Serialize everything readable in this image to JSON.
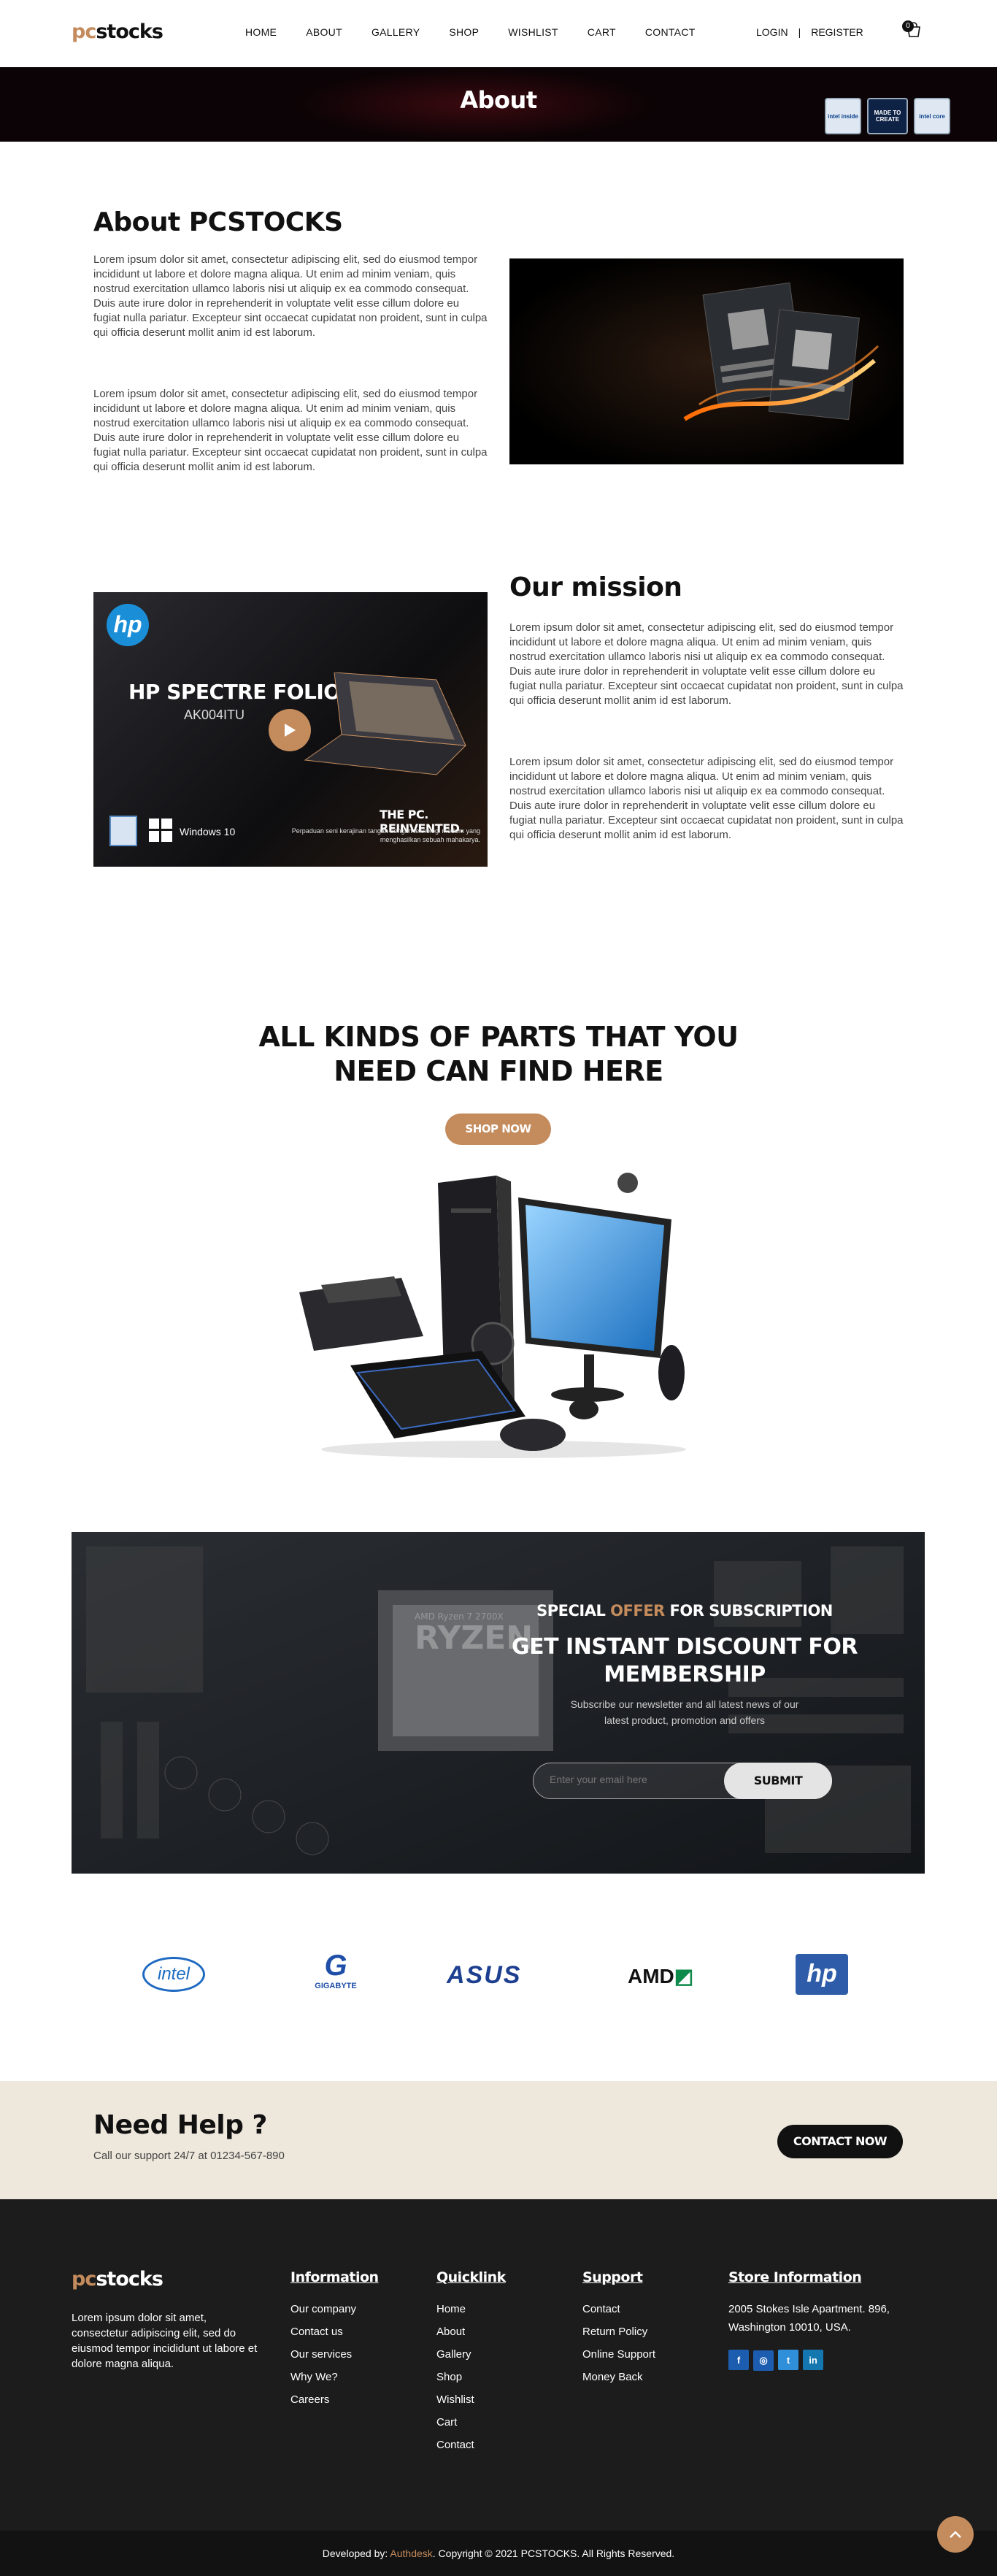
{
  "header": {
    "logo_pc": "pc",
    "logo_stocks": "stocks",
    "nav": [
      "HOME",
      "ABOUT",
      "GALLERY",
      "SHOP",
      "WISHLIST",
      "CART",
      "CONTACT"
    ],
    "login": "LOGIN",
    "separator": "|",
    "register": "REGISTER",
    "cart_count": "0"
  },
  "banner": {
    "title": "About",
    "badges": [
      "intel inside",
      "MADE TO CREATE",
      "intel core"
    ]
  },
  "about": {
    "title": "About PCSTOCKS",
    "p1": "Lorem ipsum dolor sit amet, consectetur adipiscing elit, sed do eiusmod tempor incididunt ut labore et dolore magna aliqua. Ut enim ad minim veniam, quis nostrud exercitation ullamco laboris nisi ut aliquip ex ea commodo consequat. Duis aute irure dolor in reprehenderit in voluptate velit esse cillum dolore eu fugiat nulla pariatur. Excepteur sint occaecat cupidatat non proident, sunt in culpa qui officia deserunt mollit anim id est laborum.",
    "p2": "Lorem ipsum dolor sit amet, consectetur adipiscing elit, sed do eiusmod tempor incididunt ut labore et dolore magna aliqua. Ut enim ad minim veniam, quis nostrud exercitation ullamco laboris nisi ut aliquip ex ea commodo consequat. Duis aute irure dolor in reprehenderit in voluptate velit esse cillum dolore eu fugiat nulla pariatur. Excepteur sint occaecat cupidatat non proident, sunt in culpa qui officia deserunt mollit anim id est laborum."
  },
  "mission": {
    "title": "Our mission",
    "p1": "Lorem ipsum dolor sit amet, consectetur adipiscing elit, sed do eiusmod tempor incididunt ut labore et dolore magna aliqua. Ut enim ad minim veniam, quis nostrud exercitation ullamco laboris nisi ut aliquip ex ea commodo consequat. Duis aute irure dolor in reprehenderit in voluptate velit esse cillum dolore eu fugiat nulla pariatur. Excepteur sint occaecat cupidatat non proident, sunt in culpa qui officia deserunt mollit anim id est laborum.",
    "p2": "Lorem ipsum dolor sit amet, consectetur adipiscing elit, sed do eiusmod tempor incididunt ut labore et dolore magna aliqua. Ut enim ad minim veniam, quis nostrud exercitation ullamco laboris nisi ut aliquip ex ea commodo consequat. Duis aute irure dolor in reprehenderit in voluptate velit esse cillum dolore eu fugiat nulla pariatur. Excepteur sint occaecat cupidatat non proident, sunt in culpa qui officia deserunt mollit anim id est laborum.",
    "video": {
      "brand": "hp",
      "model": "HP SPECTRE FOLIO 13",
      "code": "AK004ITU",
      "tagline": "THE PC. REINVENTED.",
      "subline1": "Perpaduan seni kerajinan tangan dengan teknologi modern yang",
      "subline2": "menghasilkan sebuah mahakarya.",
      "os": "Windows 10"
    }
  },
  "parts": {
    "line1": "ALL KINDS OF PARTS THAT YOU",
    "line2": "NEED CAN FIND HERE",
    "button": "SHOP NOW"
  },
  "subscribe": {
    "special": "SPECIAL ",
    "offer": "OFFER",
    "for_sub": " FOR SUBSCRIPTION",
    "headline1": "GET INSTANT DISCOUNT FOR",
    "headline2": "MEMBERSHIP",
    "desc1": "Subscribe our newsletter and all latest news of our",
    "desc2": "latest product, promotion and offers",
    "placeholder": "Enter your email here",
    "button": "SUBMIT",
    "chip1": "AMD Ryzen 7 2700X",
    "chip2": "RYZEN"
  },
  "brands": [
    "intel",
    "GIGABYTE",
    "ASUS",
    "AMD",
    "hp"
  ],
  "help": {
    "title": "Need Help ?",
    "text": "Call our support 24/7 at 01234-567-890",
    "button": "CONTACT NOW"
  },
  "footer": {
    "about": "Lorem ipsum dolor sit amet, consectetur adipiscing elit, sed do eiusmod tempor incididunt ut labore et dolore magna aliqua.",
    "information": {
      "title": "Information",
      "items": [
        "Our company",
        "Contact us",
        "Our services",
        "Why We?",
        "Careers"
      ]
    },
    "quicklink": {
      "title": "Quicklink",
      "items": [
        "Home",
        "About",
        "Gallery",
        "Shop",
        "Wishlist",
        "Cart",
        "Contact"
      ]
    },
    "support": {
      "title": "Support",
      "items": [
        "Contact",
        "Return Policy",
        "Online Support",
        "Money Back"
      ]
    },
    "store": {
      "title": "Store Information",
      "address1": "2005 Stokes Isle Apartment. 896,",
      "address2": "Washington 10010, USA."
    },
    "social": [
      "f",
      "◎",
      "t",
      "in"
    ]
  },
  "copyright": {
    "prefix": "Developed by: ",
    "author": "Authdesk",
    "suffix": ". Copyright © 2021 PCSTOCKS. All Rights Reserved."
  },
  "colors": {
    "accent": "#c48b5c",
    "dark": "#1c1c1c",
    "bg_help": "#ede7dc"
  }
}
